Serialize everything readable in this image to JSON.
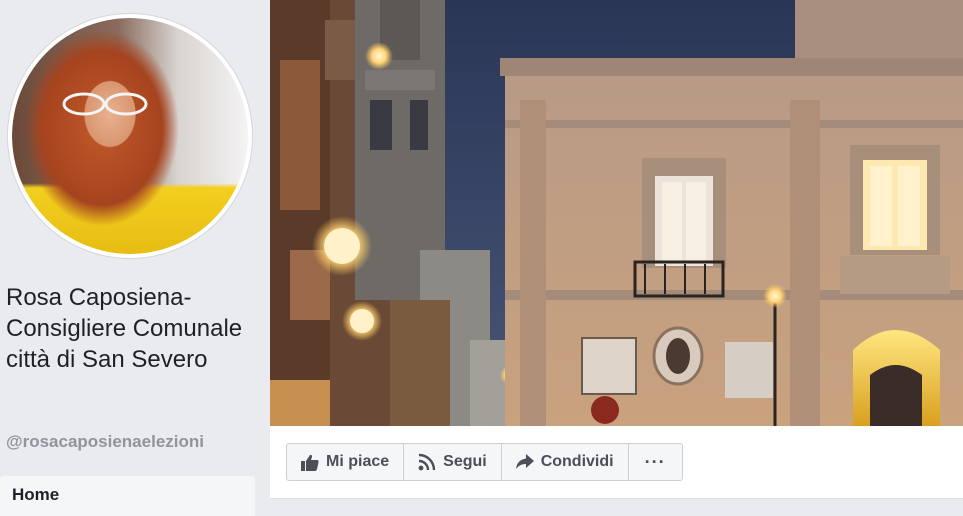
{
  "page": {
    "name": "Rosa Caposiena- Consigliere Comunale città di San Severo",
    "handle": "@rosacaposienaelezioni"
  },
  "nav": {
    "home_label": "Home"
  },
  "actions": {
    "like_label": "Mi piace",
    "follow_label": "Segui",
    "share_label": "Condividi",
    "more_label": "···"
  },
  "icons": {
    "like": "thumbs-up-icon",
    "follow": "rss-feed-icon",
    "share": "share-arrow-icon",
    "more": "ellipsis-icon"
  },
  "colors": {
    "background": "#e9ebee",
    "text": "#1d2129",
    "muted": "#90949c",
    "button_text": "#4b4f56"
  }
}
